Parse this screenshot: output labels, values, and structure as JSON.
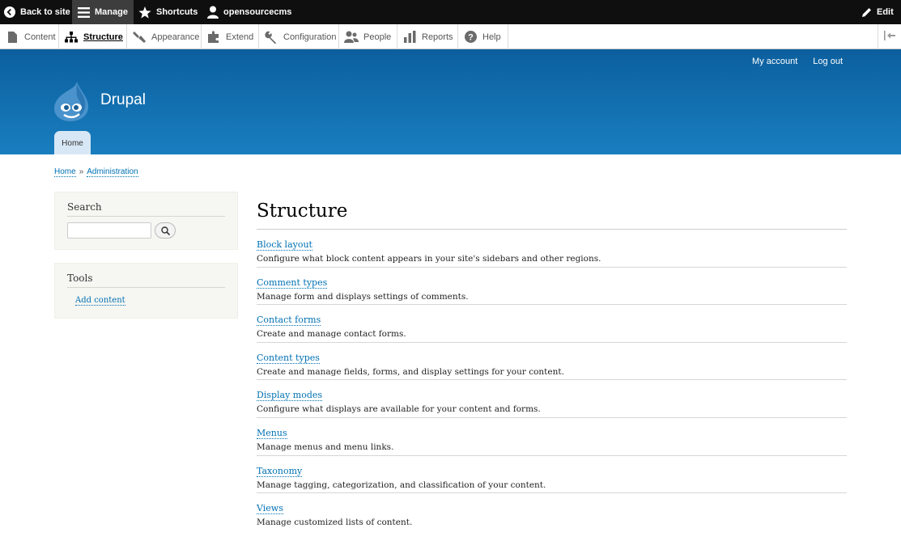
{
  "toolbar": {
    "back_to_site": "Back to site",
    "manage": "Manage",
    "shortcuts": "Shortcuts",
    "user": "opensourcecms",
    "edit": "Edit"
  },
  "tray": {
    "items": [
      {
        "label": "Content",
        "icon": "file-icon"
      },
      {
        "label": "Structure",
        "icon": "sitemap-icon"
      },
      {
        "label": "Appearance",
        "icon": "wrench-icon"
      },
      {
        "label": "Extend",
        "icon": "puzzle-icon"
      },
      {
        "label": "Configuration",
        "icon": "wrench-icon"
      },
      {
        "label": "People",
        "icon": "people-icon"
      },
      {
        "label": "Reports",
        "icon": "bar-chart-icon"
      },
      {
        "label": "Help",
        "icon": "help-icon"
      }
    ],
    "active": "Structure"
  },
  "header": {
    "site_name": "Drupal",
    "my_account": "My account",
    "log_out": "Log out",
    "home_tab": "Home",
    "gradient": [
      "#0c5f9e",
      "#197ebf"
    ]
  },
  "breadcrumb": {
    "home": "Home",
    "separator": "»",
    "administration": "Administration"
  },
  "sidebar": {
    "search_title": "Search",
    "tools_title": "Tools",
    "add_content": "Add content"
  },
  "main": {
    "title": "Structure",
    "items": [
      {
        "link": "Block layout",
        "desc": "Configure what block content appears in your site's sidebars and other regions."
      },
      {
        "link": "Comment types",
        "desc": "Manage form and displays settings of comments."
      },
      {
        "link": "Contact forms",
        "desc": "Create and manage contact forms."
      },
      {
        "link": "Content types",
        "desc": "Create and manage fields, forms, and display settings for your content."
      },
      {
        "link": "Display modes",
        "desc": "Configure what displays are available for your content and forms."
      },
      {
        "link": "Menus",
        "desc": "Manage menus and menu links."
      },
      {
        "link": "Taxonomy",
        "desc": "Manage tagging, categorization, and classification of your content."
      },
      {
        "link": "Views",
        "desc": "Manage customized lists of content."
      }
    ]
  },
  "colors": {
    "link": "#0071b3",
    "toolbar": "#0f0f0f"
  }
}
